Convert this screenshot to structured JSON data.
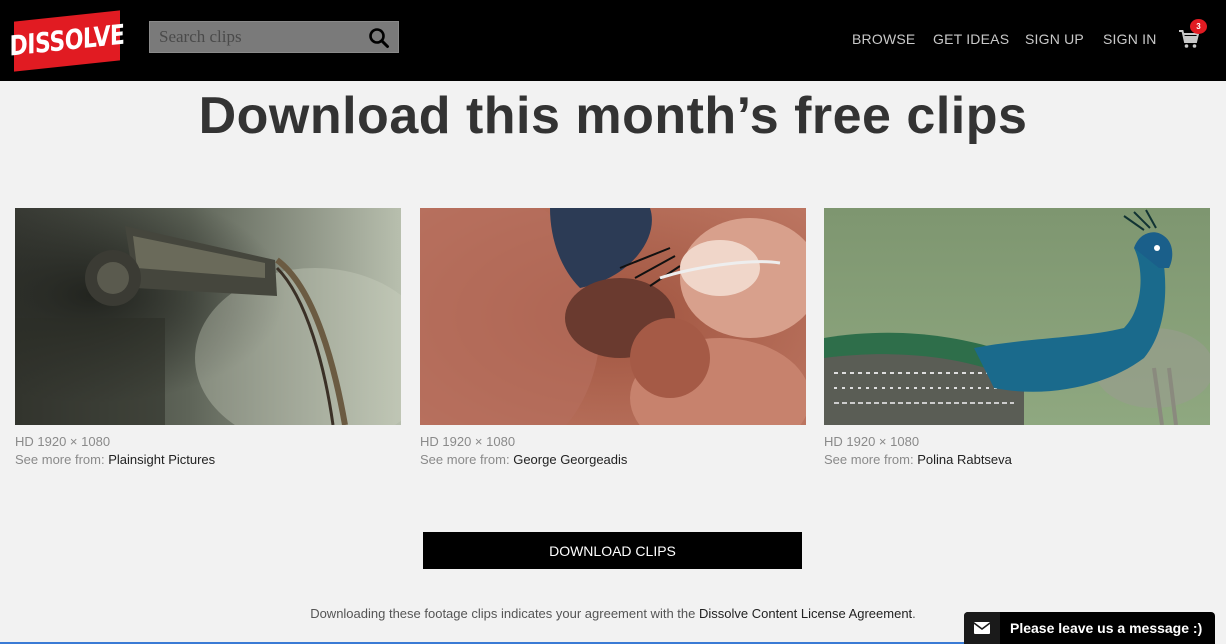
{
  "header": {
    "logo_text": "DISSOLVE",
    "search_placeholder": "Search clips",
    "nav": [
      "BROWSE",
      "GET IDEAS",
      "SIGN UP",
      "SIGN IN"
    ],
    "cart_count": "3"
  },
  "main": {
    "headline": "Download this month’s free clips",
    "clips": [
      {
        "resolution": "HD 1920 × 1080",
        "from_label": "See more from:",
        "author": "Plainsight Pictures"
      },
      {
        "resolution": "HD 1920 × 1080",
        "from_label": "See more from:",
        "author": "George Georgeadis"
      },
      {
        "resolution": "HD 1920 × 1080",
        "from_label": "See more from:",
        "author": "Polina Rabtseva"
      }
    ],
    "download_label": "DOWNLOAD CLIPS",
    "agreement_prefix": "Downloading these footage clips indicates your agreement with the ",
    "agreement_link": "Dissolve Content License Agreement",
    "agreement_suffix": "."
  },
  "chat": {
    "label": "Please leave us a message :)"
  },
  "colors": {
    "brand_red": "#e11b22",
    "header_bg": "#000000",
    "page_bg": "#f2f2f2"
  },
  "icons": [
    "search-icon",
    "cart-icon",
    "envelope-icon"
  ]
}
